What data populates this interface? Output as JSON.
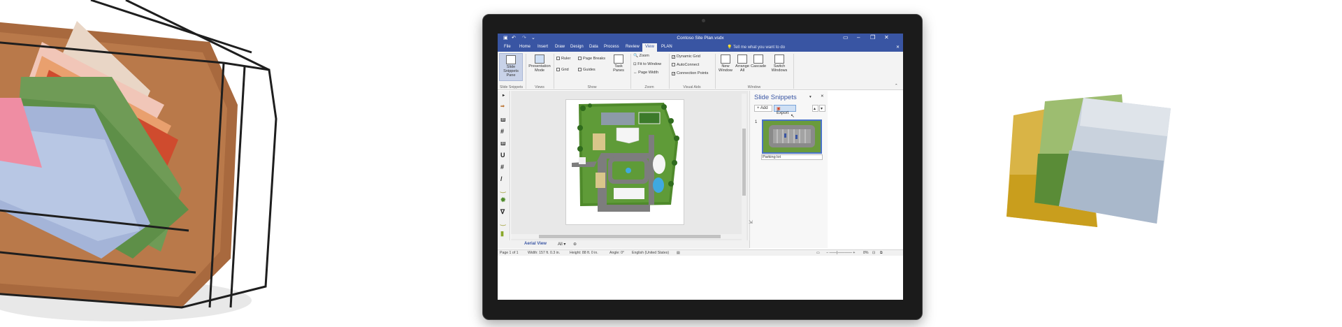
{
  "window": {
    "title": "Contoso Site Plan.vsdx",
    "quick_access": [
      "save-icon",
      "undo-icon",
      "redo-icon",
      "customize-icon"
    ],
    "controls": [
      "ribbon-display-icon",
      "minimize-icon",
      "restore-icon",
      "close-icon"
    ]
  },
  "tabs": [
    "File",
    "Home",
    "Insert",
    "Draw",
    "Design",
    "Data",
    "Process",
    "Review",
    "View",
    "PLAN"
  ],
  "active_tab": "View",
  "tell_me": "Tell me what you want to do",
  "ribbon": {
    "slide_snippets_btn": "Slide Snippets Pane",
    "presentation_mode_btn": "Presentation Mode",
    "ruler": "Ruler",
    "page_breaks": "Page Breaks",
    "grid": "Grid",
    "guides": "Guides",
    "task_panes": "Task Panes",
    "zoom": "Zoom",
    "fit_to_window": "Fit to Window",
    "page_width": "Page Width",
    "dynamic_grid": "Dynamic Grid",
    "autoconnect": "AutoConnect",
    "connection_points": "Connection Points",
    "new_window": "New Window",
    "arrange_all": "Arrange All",
    "cascade": "Cascade",
    "switch_windows": "Switch Windows",
    "groups": {
      "slide_snippets": "Slide Snippets",
      "views": "Views",
      "show": "Show",
      "zoom": "Zoom",
      "visual_aids": "Visual Aids",
      "window": "Window"
    }
  },
  "pane": {
    "title": "Slide Snippets",
    "add": "Add",
    "export": "Export",
    "snippet_number": "1",
    "snippet_name": "Parking lot"
  },
  "sheet": {
    "tab": "Aerial View",
    "all": "All"
  },
  "status": {
    "page": "Page 1 of 1",
    "width": "Width: 157 ft. 0.3 in.",
    "height": "Height: 88 ft. 0 in.",
    "angle": "Angle: 0°",
    "language": "English (United States)",
    "zoom": "8%"
  },
  "colors": {
    "accent": "#3955a3",
    "lawn": "#4f8a2b",
    "road": "#7d7d7d",
    "water": "#3fa9e0"
  }
}
